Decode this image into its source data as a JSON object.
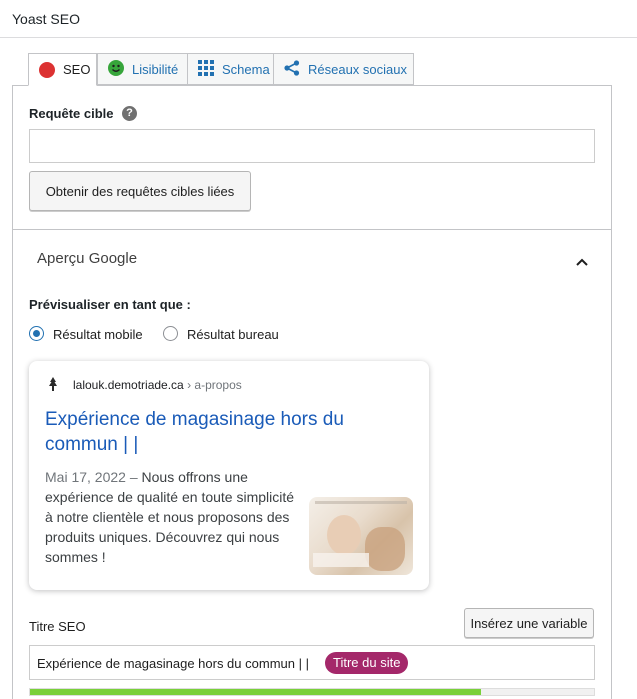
{
  "panel": {
    "title": "Yoast SEO"
  },
  "tabs": [
    {
      "label": "SEO",
      "icon": "red-dot-icon",
      "active": true
    },
    {
      "label": "Lisibilité",
      "icon": "smiley-icon"
    },
    {
      "label": "Schema",
      "icon": "grid-icon"
    },
    {
      "label": "Réseaux sociaux",
      "icon": "share-icon"
    }
  ],
  "focus": {
    "label": "Requête cible",
    "help": "?",
    "value": "",
    "related_button": "Obtenir des requêtes cibles liées"
  },
  "preview": {
    "title": "Aperçu Google",
    "mode_label": "Prévisualiser en tant que :",
    "mobile": "Résultat mobile",
    "desktop": "Résultat bureau",
    "selected": "mobile",
    "domain": "lalouk.demotriade.ca",
    "path": " › a-propos",
    "result_title": "Expérience de magasinage hors du commun | |",
    "date": "Mai 17, 2022",
    "date_sep": " – ",
    "description": "Nous offrons une expérience de qualité en toute simplicité à notre clientèle et nous proposons des produits uniques. Découvrez qui nous sommes !"
  },
  "seo_title": {
    "label": "Titre SEO",
    "insert_button": "Insérez une variable",
    "value": "Expérience de magasinage hors du commun | |",
    "variable": "Titre du site",
    "progress": 0.8
  },
  "colors": {
    "accent": "#2271b1",
    "pill": "#a4286a",
    "progress": "#7ad03a",
    "link": "#1a5bb8"
  }
}
